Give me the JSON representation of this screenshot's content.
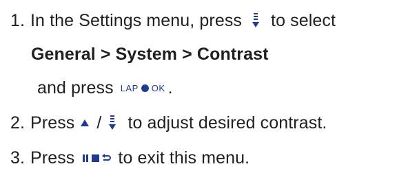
{
  "steps": [
    {
      "number": "1.",
      "text_before_icon": "In the Settings menu, press",
      "text_after_icon": "to select",
      "menu_path": "General > System > Contrast",
      "press_prefix": "and press",
      "press_suffix": ".",
      "button_icon_label_left": "LAP",
      "button_icon_label_right": "OK"
    },
    {
      "number": "2.",
      "text_before_icon": "Press",
      "separator": "/",
      "text_after_icon": "to adjust desired contrast."
    },
    {
      "number": "3.",
      "text_before_icon": "Press",
      "text_after_icon": "to exit this menu."
    }
  ],
  "icons": {
    "menu_down": "menu-down-icon",
    "lap_ok": "lap-ok-button-icon",
    "up": "up-arrow-icon",
    "pause_stop_back": "pause-stop-back-icon",
    "accent_color": "#1f3a93"
  }
}
